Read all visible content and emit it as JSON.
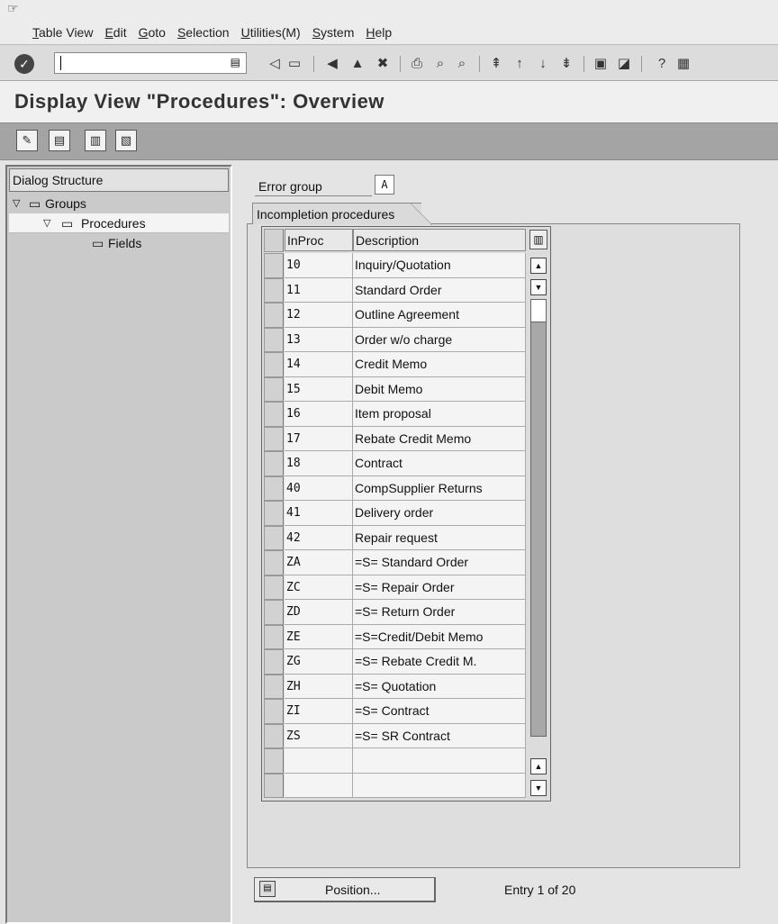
{
  "menubar": {
    "toggle_icon": "menu-toggle-icon",
    "items": [
      "Table View",
      "Edit",
      "Goto",
      "Selection",
      "Utilities(M)",
      "System",
      "Help"
    ]
  },
  "toolbar": {
    "command_field_value": ""
  },
  "title": "Display View \"Procedures\": Overview",
  "dialog_structure": {
    "header": "Dialog Structure",
    "nodes": [
      {
        "label": "Groups",
        "expanded": true
      },
      {
        "label": "Procedures",
        "expanded": true
      },
      {
        "label": "Fields",
        "expanded": false
      }
    ]
  },
  "error_group": {
    "label": "Error group",
    "value": "A"
  },
  "group_box": {
    "title": "Incompletion procedures"
  },
  "table": {
    "columns": [
      "InProc",
      "Description"
    ],
    "rows": [
      [
        "10",
        "Inquiry/Quotation"
      ],
      [
        "11",
        "Standard Order"
      ],
      [
        "12",
        "Outline Agreement"
      ],
      [
        "13",
        "Order w/o charge"
      ],
      [
        "14",
        "Credit Memo"
      ],
      [
        "15",
        "Debit Memo"
      ],
      [
        "16",
        "Item proposal"
      ],
      [
        "17",
        "Rebate Credit Memo"
      ],
      [
        "18",
        "Contract"
      ],
      [
        "40",
        "CompSupplier Returns"
      ],
      [
        "41",
        "Delivery order"
      ],
      [
        "42",
        "Repair request"
      ],
      [
        "ZA",
        "=S= Standard Order"
      ],
      [
        "ZC",
        "=S= Repair Order"
      ],
      [
        "ZD",
        "=S= Return Order"
      ],
      [
        "ZE",
        "=S=Credit/Debit Memo"
      ],
      [
        "ZG",
        "=S= Rebate Credit M."
      ],
      [
        "ZH",
        "=S= Quotation"
      ],
      [
        "ZI",
        "=S= Contract"
      ],
      [
        "ZS",
        "=S= SR Contract"
      ],
      [
        "",
        ""
      ],
      [
        "",
        ""
      ]
    ]
  },
  "footer": {
    "position_button": "Position...",
    "entry_text": "Entry 1 of 20"
  }
}
